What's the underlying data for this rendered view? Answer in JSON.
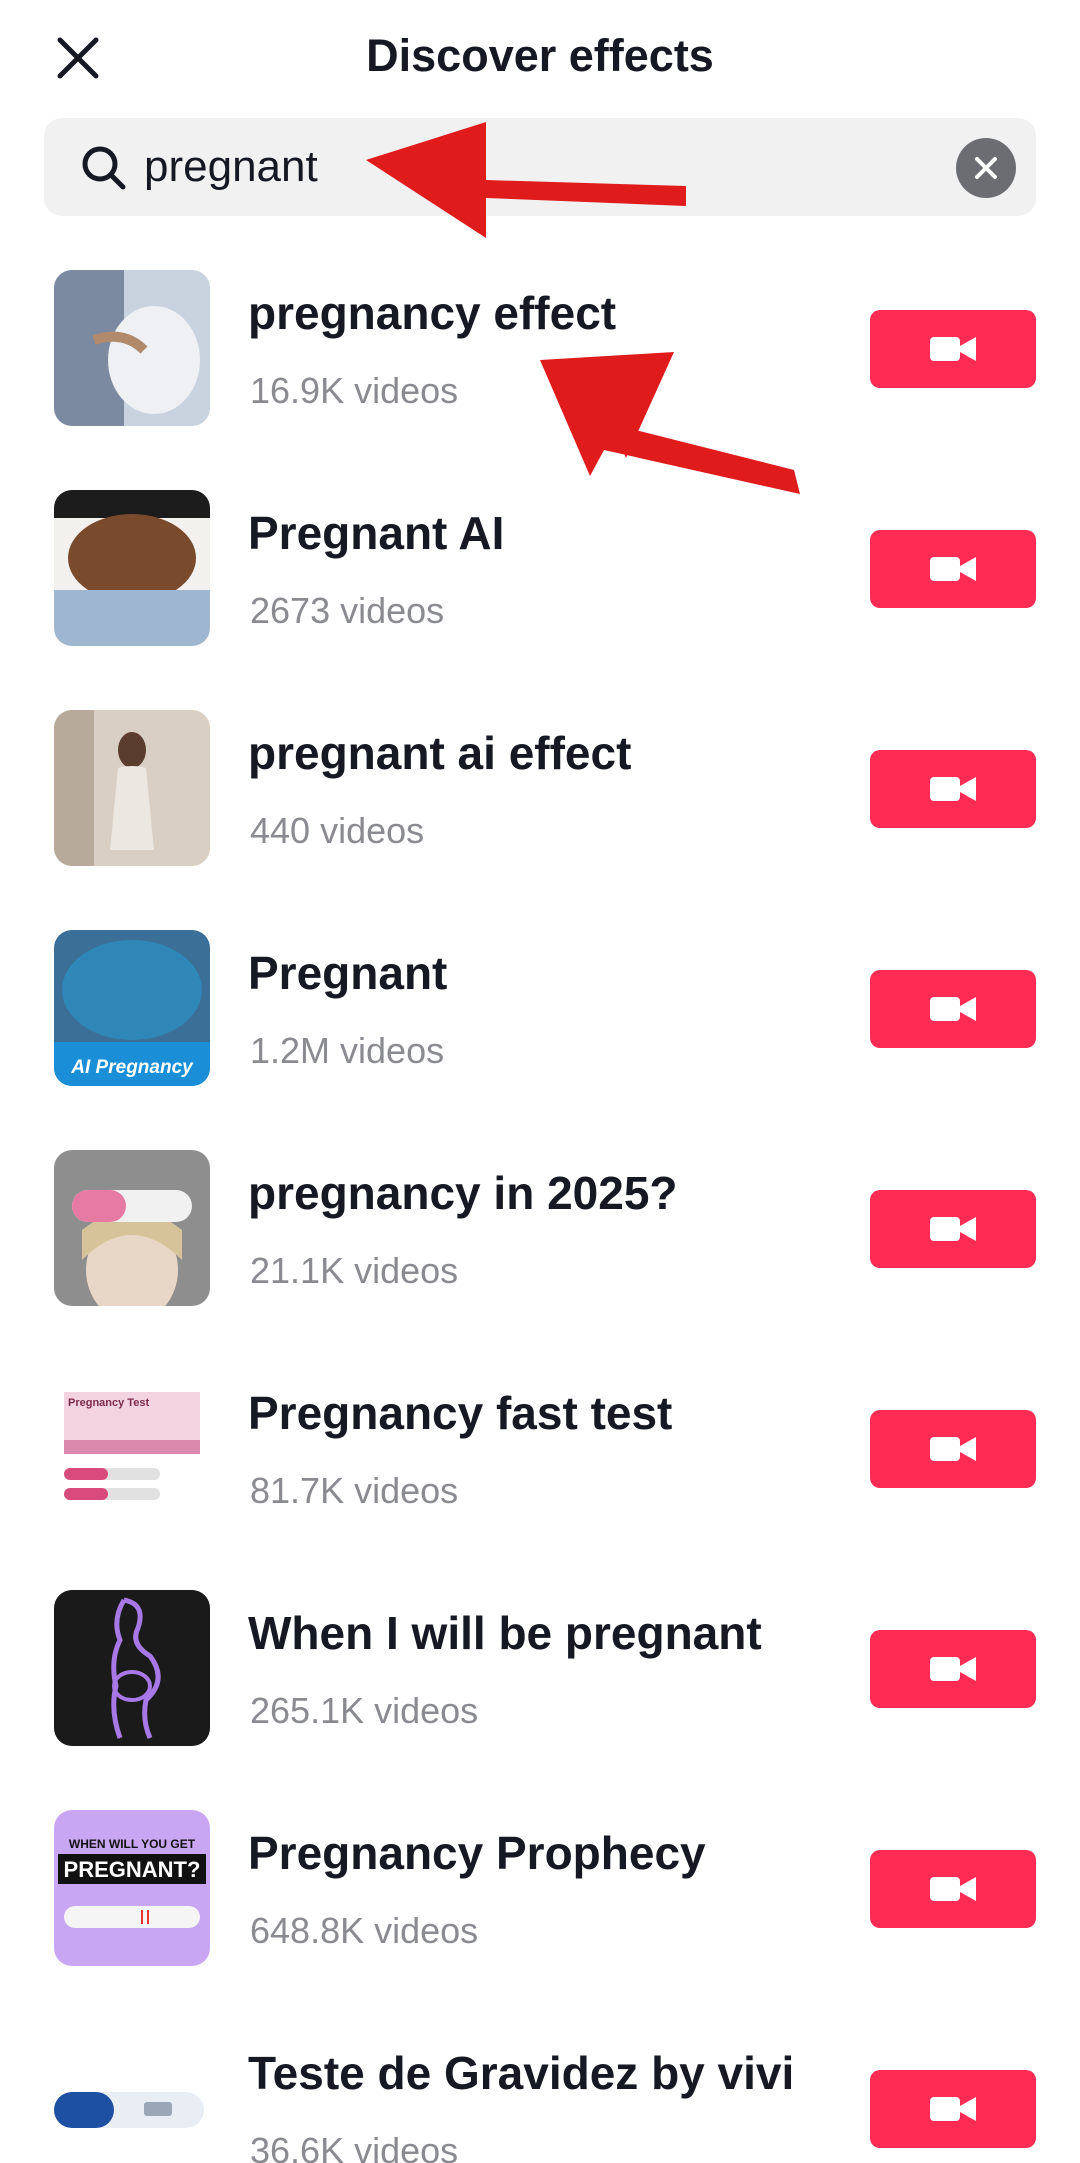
{
  "header": {
    "title": "Discover effects",
    "close_icon": "close-icon"
  },
  "search": {
    "value": "pregnant",
    "icon": "search-icon",
    "clear_icon": "clear-icon"
  },
  "accent_color": "#fe2c55",
  "annotation_color": "#e01b1b",
  "effects": [
    {
      "name": "pregnancy effect",
      "count": "16.9K videos"
    },
    {
      "name": "Pregnant AI",
      "count": "2673 videos"
    },
    {
      "name": "pregnant ai effect",
      "count": "440 videos"
    },
    {
      "name": "Pregnant",
      "count": "1.2M videos",
      "thumb_caption": "AI Pregnancy"
    },
    {
      "name": "pregnancy in 2025?",
      "count": "21.1K videos"
    },
    {
      "name": "Pregnancy fast test",
      "count": "81.7K videos",
      "thumb_caption": "Pregnancy Test"
    },
    {
      "name": "When I will be pregnant",
      "count": "265.1K videos"
    },
    {
      "name": "Pregnancy Prophecy",
      "count": "648.8K videos",
      "thumb_caption_top": "WHEN WILL YOU GET",
      "thumb_caption_main": "PREGNANT?"
    },
    {
      "name": "Teste de Gravidez by vivi",
      "count": "36.6K videos"
    }
  ]
}
